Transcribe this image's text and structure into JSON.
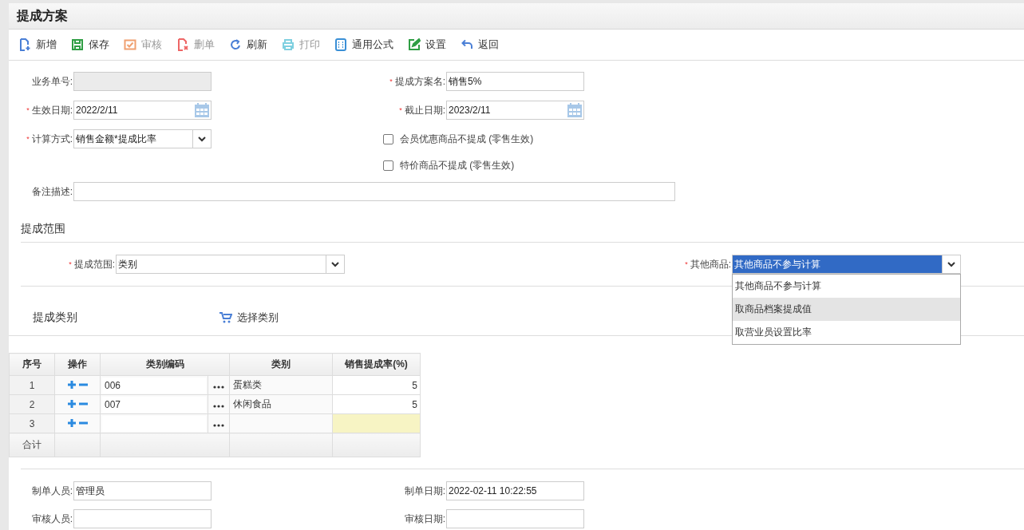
{
  "window": {
    "title": "提成方案"
  },
  "toolbar": [
    {
      "kind": "add",
      "label": "新增",
      "disabled": false
    },
    {
      "kind": "save",
      "label": "保存",
      "disabled": false
    },
    {
      "kind": "audit",
      "label": "审核",
      "disabled": true
    },
    {
      "kind": "delete",
      "label": "删单",
      "disabled": true
    },
    {
      "kind": "refresh",
      "label": "刷新",
      "disabled": false
    },
    {
      "kind": "print",
      "label": "打印",
      "disabled": true
    },
    {
      "kind": "formula",
      "label": "通用公式",
      "disabled": false
    },
    {
      "kind": "settings",
      "label": "设置",
      "disabled": false
    },
    {
      "kind": "back",
      "label": "返回",
      "disabled": false
    }
  ],
  "form": {
    "left": [
      {
        "kind": "text",
        "label": "业务单号:",
        "disabled": true
      },
      {
        "kind": "date",
        "required_mark": "*",
        "label": "生效日期:",
        "value": "2022/2/11",
        "disabled": false
      },
      {
        "kind": "select",
        "required_mark": "*",
        "label": "计算方式:",
        "value": "销售金额*提成比率",
        "disabled": false
      }
    ],
    "right": [
      {
        "kind": "text",
        "required_mark": "*",
        "label": "提成方案名:",
        "value": "销售5%",
        "disabled": false
      },
      {
        "kind": "date",
        "required_mark": "*",
        "label": "截止日期:",
        "value": "2023/2/11",
        "disabled": false
      }
    ],
    "checkboxes": [
      {
        "label": "会员优惠商品不提成 (零售生效)",
        "checked": false
      },
      {
        "label": "特价商品不提成 (零售生效)",
        "checked": false
      }
    ],
    "remark": {
      "label": "备注描述:"
    }
  },
  "scope_section": {
    "title": "提成范围",
    "scope": {
      "required_mark": "*",
      "label": "提成范围:",
      "value": "类别"
    },
    "other_goods": {
      "required_mark": "*",
      "label": "其他商品:",
      "value": "其他商品不参与计算",
      "expanded": true,
      "options": [
        {
          "label": "其他商品不参与计算",
          "hovered": false
        },
        {
          "label": "取商品档案提成值",
          "hovered": true
        },
        {
          "label": "取营业员设置比率",
          "hovered": false
        }
      ]
    }
  },
  "category_section": {
    "title": "提成类别",
    "select_button": "选择类别",
    "table": {
      "columns": [
        "序号",
        "操作",
        "类别编码",
        "类别",
        "销售提成率(%)"
      ],
      "rows": [
        {
          "seq": "1",
          "code": "006",
          "category": "蛋糕类",
          "rate": "5",
          "editing": false
        },
        {
          "seq": "2",
          "code": "007",
          "category": "休闲食品",
          "rate": "5",
          "editing": false
        },
        {
          "seq": "3",
          "editing": true
        }
      ],
      "total_label": "合计"
    }
  },
  "footer": [
    {
      "label": "制单人员:",
      "value": "管理员"
    },
    {
      "label": "制单日期:",
      "value": "2022-02-11 10:22:55"
    },
    {
      "label": "审核人员:"
    },
    {
      "label": "审核日期:"
    }
  ]
}
